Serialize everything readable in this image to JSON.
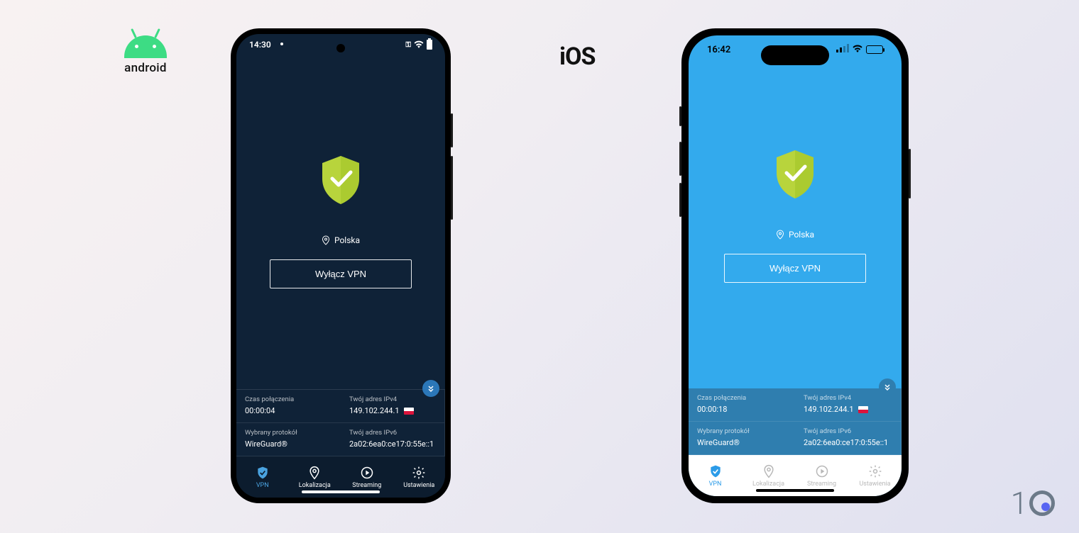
{
  "os_labels": {
    "android": "android",
    "ios": "iOS"
  },
  "android": {
    "status": {
      "time": "14:30"
    },
    "location": "Polska",
    "vpn_button": "Wyłącz VPN",
    "info": {
      "conn_time_label": "Czas połączenia",
      "conn_time_value": "00:00:04",
      "ipv4_label": "Twój adres IPv4",
      "ipv4_value": "149.102.244.1",
      "protocol_label": "Wybrany protokół",
      "protocol_value": "WireGuard®",
      "ipv6_label": "Twój adres IPv6",
      "ipv6_value": "2a02:6ea0:ce17:0:55e::1"
    },
    "nav": {
      "vpn": "VPN",
      "location": "Lokalizacja",
      "streaming": "Streaming",
      "settings": "Ustawienia"
    }
  },
  "ios": {
    "status": {
      "time": "16:42"
    },
    "location": "Polska",
    "vpn_button": "Wyłącz VPN",
    "info": {
      "conn_time_label": "Czas połączenia",
      "conn_time_value": "00:00:18",
      "ipv4_label": "Twój adres IPv4",
      "ipv4_value": "149.102.244.1",
      "protocol_label": "Wybrany protokół",
      "protocol_value": "WireGuard®",
      "ipv6_label": "Twój adres IPv6",
      "ipv6_value": "2a02:6ea0:ce17:0:55e::1"
    },
    "nav": {
      "vpn": "VPN",
      "location": "Lokalizacja",
      "streaming": "Streaming",
      "settings": "Ustawienia"
    }
  }
}
